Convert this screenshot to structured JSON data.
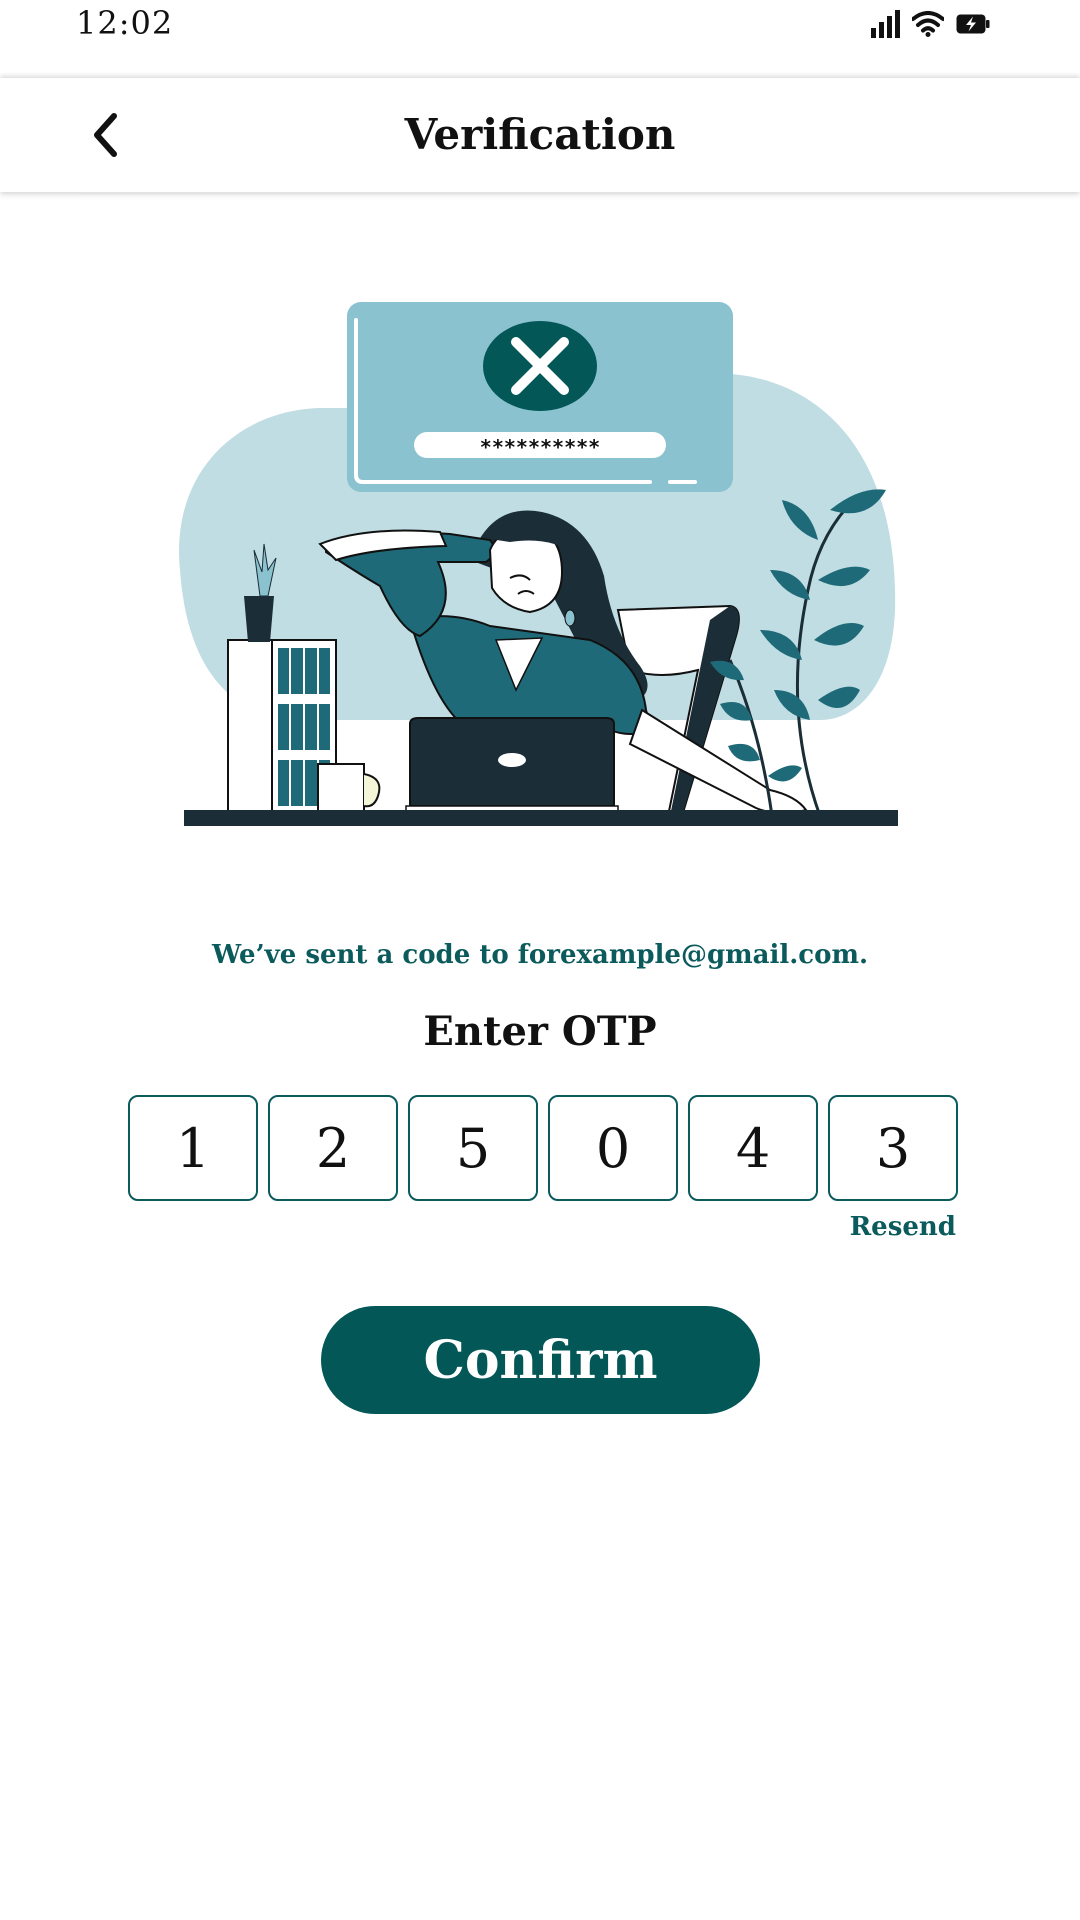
{
  "status_bar": {
    "time": "12:02",
    "icons": [
      "signal-icon",
      "wifi-icon",
      "battery-charging-icon"
    ]
  },
  "app_bar": {
    "title": "Verification",
    "back_icon": "chevron-left-icon"
  },
  "illustration": {
    "masked_password": "**********",
    "error_icon": "close-icon"
  },
  "content": {
    "sent_message": "We’ve sent a code to forexample@gmail.com.",
    "otp_heading": "Enter OTP",
    "otp_digits": [
      "1",
      "2",
      "5",
      "0",
      "4",
      "3"
    ],
    "resend_label": "Resend",
    "confirm_label": "Confirm"
  },
  "colors": {
    "accent": "#035757",
    "text_accent": "#0b5a5c",
    "illustration_light": "#bfdde3",
    "illustration_card": "#8ac2cf",
    "illustration_dark": "#1f6a78"
  }
}
